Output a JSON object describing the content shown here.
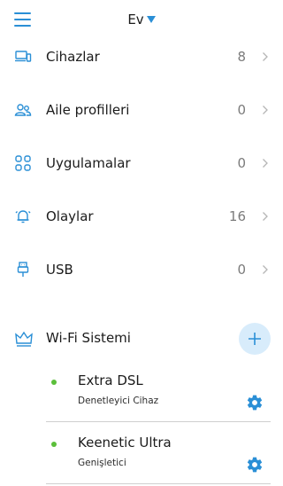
{
  "header": {
    "location": "Ev"
  },
  "menu": [
    {
      "label": "Cihazlar",
      "count": "8",
      "icon": "devices-icon"
    },
    {
      "label": "Aile profilleri",
      "count": "0",
      "icon": "family-icon"
    },
    {
      "label": "Uygulamalar",
      "count": "0",
      "icon": "apps-icon"
    },
    {
      "label": "Olaylar",
      "count": "16",
      "icon": "bell-icon"
    },
    {
      "label": "USB",
      "count": "0",
      "icon": "usb-icon"
    }
  ],
  "wifi_system": {
    "title": "Wi-Fi Sistemi",
    "devices": [
      {
        "name": "Extra DSL",
        "role": "Denetleyici Cihaz",
        "status_color": "#5bbf3a"
      },
      {
        "name": "Keenetic Ultra",
        "role": "Genişletici",
        "status_color": "#5bbf3a"
      }
    ]
  },
  "colors": {
    "accent": "#2a8fd6",
    "online": "#5bbf3a",
    "add_button_bg": "#d8ecfb"
  }
}
